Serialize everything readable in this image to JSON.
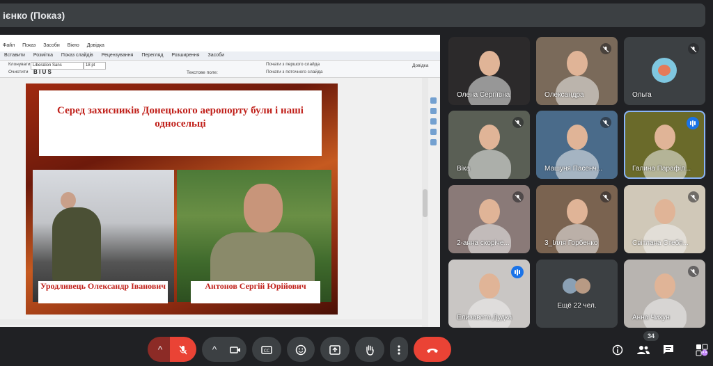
{
  "header": {
    "title": "ієнко (Показ)"
  },
  "presentation": {
    "menu": [
      "Файл",
      "Показ",
      "Засоби",
      "Вікно",
      "Довідка"
    ],
    "tabs": [
      "Вставити",
      "Розмітка",
      "Показ слайдів",
      "Рецензування",
      "Перегляд",
      "Розширення",
      "Засоби"
    ],
    "toolbar": {
      "clone": "Клонувати",
      "clear": "Очистити",
      "font": "Liberation Sans",
      "size": "18 pt",
      "text_field": "Текстове поле:",
      "from_first": "Почати з першого слайда",
      "from_current": "Почати з поточного слайда",
      "help": "Довідка"
    },
    "slide": {
      "title": "Серед захисників Донецького аеропорту були і наші односельці",
      "caption1": "Уродливець Олександр Іванович",
      "caption2": "Антонов Сергій Юрійович"
    }
  },
  "participants": [
    {
      "name": "Олена Сергіївна",
      "muted": false,
      "speaking": false,
      "bg": "#2c2a2b"
    },
    {
      "name": "Олександра",
      "muted": true,
      "speaking": false,
      "bg": "#7a6a5a"
    },
    {
      "name": "Ольга",
      "muted": true,
      "speaking": false,
      "bg": "#3c4043",
      "avatar": true
    },
    {
      "name": "Віка",
      "muted": true,
      "speaking": false,
      "bg": "#5a5f55"
    },
    {
      "name": "Машуня Пасенч...",
      "muted": true,
      "speaking": false,
      "bg": "#4a6b8a"
    },
    {
      "name": "Галина Парафіл...",
      "muted": false,
      "speaking": true,
      "bg": "#6a6a2a"
    },
    {
      "name": "2-анна скоріче...",
      "muted": true,
      "speaking": false,
      "bg": "#8a7a78"
    },
    {
      "name": "3_Ілля Горбенко",
      "muted": true,
      "speaking": false,
      "bg": "#7a6350"
    },
    {
      "name": "Світлана Стебл...",
      "muted": true,
      "speaking": false,
      "bg": "#d0c8b8"
    },
    {
      "name": "Елизавета Дудка",
      "muted": false,
      "speaking": true,
      "bg": "#c9c6c4"
    },
    {
      "name": "Ещё 22 чел.",
      "muted": false,
      "speaking": false,
      "bg": "#3c4043",
      "more": true
    },
    {
      "name": "Анна Чихун",
      "muted": true,
      "speaking": false,
      "bg": "#b8b4b0"
    }
  ],
  "controls": {
    "participants_count": "34"
  },
  "colors": {
    "background": "#202124",
    "tile": "#3c4043",
    "end_call": "#ea4335",
    "speaking": "#1a73e8"
  }
}
